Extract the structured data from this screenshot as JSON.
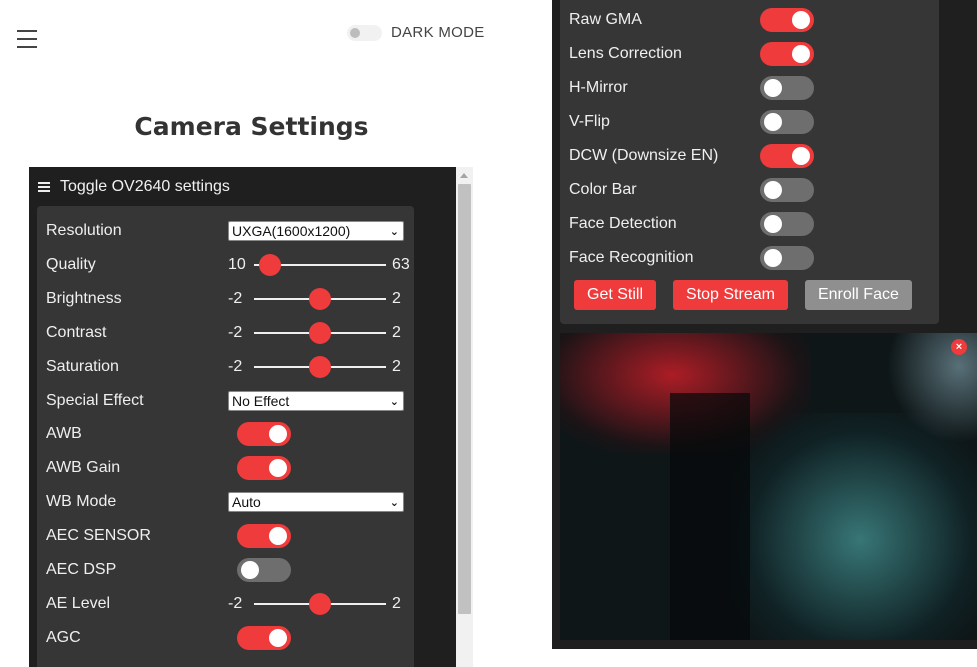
{
  "header": {
    "dark_mode_label": "DARK MODE",
    "dark_mode_on": false
  },
  "page_title": "Camera Settings",
  "settings_panel": {
    "toggle_label": "Toggle OV2640 settings",
    "rows": [
      {
        "label": "Resolution",
        "type": "select",
        "value": "UXGA(1600x1200)"
      },
      {
        "label": "Quality",
        "type": "range",
        "min": "10",
        "max": "63",
        "fraction": 0.12
      },
      {
        "label": "Brightness",
        "type": "range",
        "min": "-2",
        "max": "2",
        "fraction": 0.5
      },
      {
        "label": "Contrast",
        "type": "range",
        "min": "-2",
        "max": "2",
        "fraction": 0.5
      },
      {
        "label": "Saturation",
        "type": "range",
        "min": "-2",
        "max": "2",
        "fraction": 0.5
      },
      {
        "label": "Special Effect",
        "type": "select",
        "value": "No Effect"
      },
      {
        "label": "AWB",
        "type": "switch",
        "on": true
      },
      {
        "label": "AWB Gain",
        "type": "switch",
        "on": true
      },
      {
        "label": "WB Mode",
        "type": "select",
        "value": "Auto"
      },
      {
        "label": "AEC SENSOR",
        "type": "switch",
        "on": true
      },
      {
        "label": "AEC DSP",
        "type": "switch",
        "on": false
      },
      {
        "label": "AE Level",
        "type": "range",
        "min": "-2",
        "max": "2",
        "fraction": 0.5
      },
      {
        "label": "AGC",
        "type": "switch",
        "on": true
      }
    ]
  },
  "right_panel": {
    "rows": [
      {
        "label": "Raw GMA",
        "on": true
      },
      {
        "label": "Lens Correction",
        "on": true
      },
      {
        "label": "H-Mirror",
        "on": false
      },
      {
        "label": "V-Flip",
        "on": false
      },
      {
        "label": "DCW (Downsize EN)",
        "on": true
      },
      {
        "label": "Color Bar",
        "on": false
      },
      {
        "label": "Face Detection",
        "on": false
      },
      {
        "label": "Face Recognition",
        "on": false
      }
    ],
    "buttons": {
      "get_still": "Get Still",
      "stop_stream": "Stop Stream",
      "enroll_face": "Enroll Face"
    },
    "close_glyph": "×"
  },
  "colors": {
    "accent": "#ef3b3b",
    "panel": "#1f1f1f",
    "inner": "#363636",
    "switch_off": "#6e6e6e"
  },
  "icons": [
    "menu-icon",
    "close-icon",
    "chevron-down-icon"
  ]
}
